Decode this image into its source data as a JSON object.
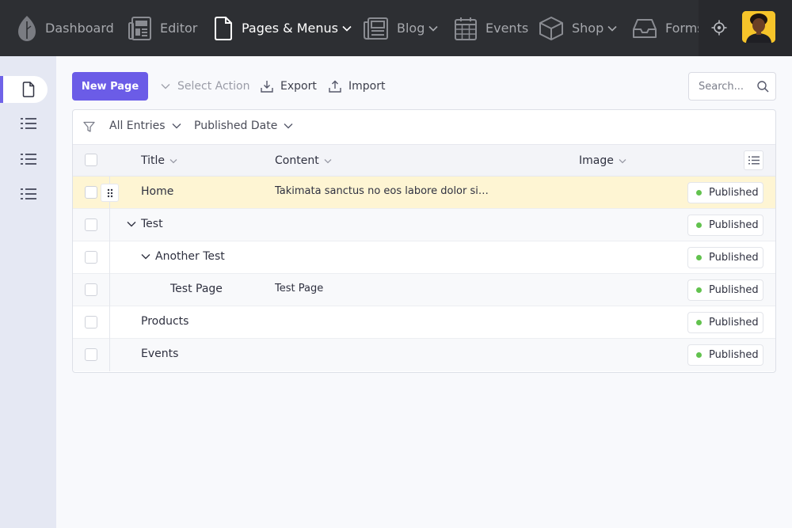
{
  "nav": {
    "items": [
      {
        "label": "Dashboard",
        "icon": "leaf-icon"
      },
      {
        "label": "Editor",
        "icon": "newspaper-icon"
      },
      {
        "label": "Pages & Menus",
        "icon": "file-icon"
      },
      {
        "label": "Blog",
        "icon": "blog-icon"
      },
      {
        "label": "Events",
        "icon": "calendar-icon"
      },
      {
        "label": "Shop",
        "icon": "box-icon"
      },
      {
        "label": "Forms",
        "icon": "inbox-icon"
      }
    ]
  },
  "toolbar": {
    "new_page_label": "New Page",
    "select_action_label": "Select Action",
    "export_label": "Export",
    "import_label": "Import",
    "search_placeholder": "Search..."
  },
  "filters": {
    "entries_label": "All Entries",
    "date_label": "Published Date"
  },
  "table": {
    "columns": {
      "title": "Title",
      "content": "Content",
      "image": "Image"
    },
    "rows": [
      {
        "title": "Home",
        "content": "Takimata sanctus no eos labore dolor sit amet ipsum dolor",
        "status": "Published"
      },
      {
        "title": "Test",
        "content": "",
        "status": "Published"
      },
      {
        "title": "Another Test",
        "content": "",
        "status": "Published"
      },
      {
        "title": "Test Page",
        "content": "Test Page",
        "status": "Published"
      },
      {
        "title": "Products",
        "content": "",
        "status": "Published"
      },
      {
        "title": "Events",
        "content": "",
        "status": "Published"
      }
    ]
  },
  "colors": {
    "accent": "#6b5ce7",
    "topbar": "#2d2f33",
    "highlight_row": "#fef5d3",
    "status_published": "#62c24e"
  }
}
